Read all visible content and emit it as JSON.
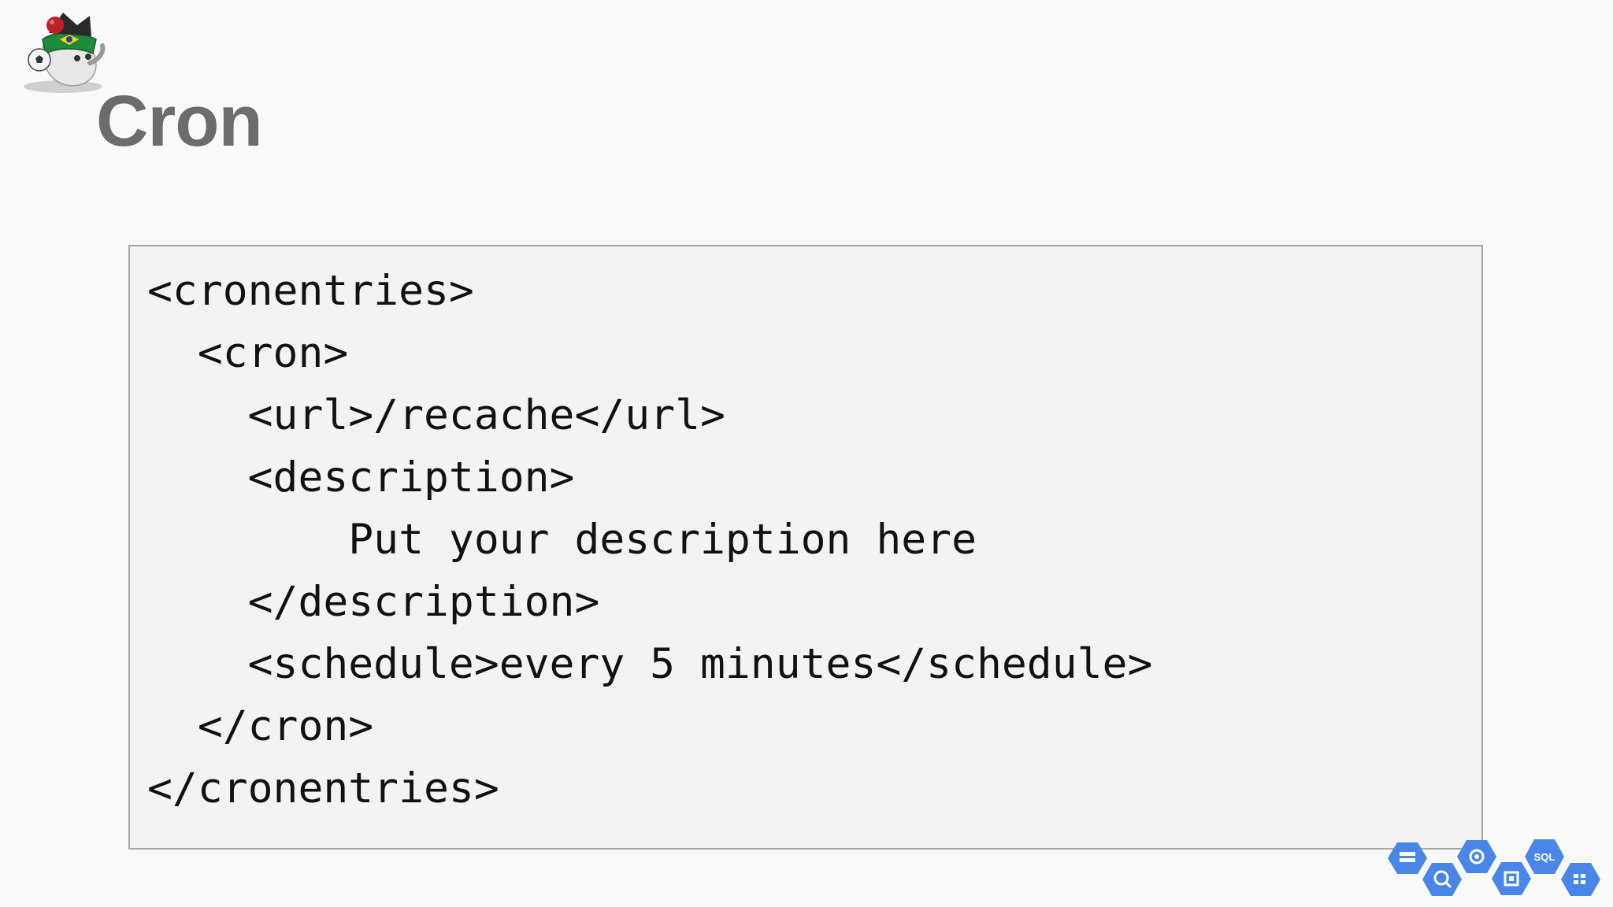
{
  "slide": {
    "title": "Cron",
    "code_lines": [
      "<cronentries>",
      "  <cron>",
      "    <url>/recache</url>",
      "    <description>",
      "        Put your description here",
      "    </description>",
      "    <schedule>every 5 minutes</schedule>",
      "  </cron>",
      "</cronentries>"
    ],
    "product_logos": {
      "sql_label": "SQL"
    }
  },
  "colors": {
    "title": "#6c6c6c",
    "code_background": "#f4f2f3",
    "code_border": "#a6a6a6",
    "logo_blue": "#4a86e8"
  },
  "icons": {
    "mascot": "cloud-mascot-icon",
    "storage": "storage-icon",
    "bigquery": "bigquery-icon",
    "endpoints": "endpoints-icon",
    "compute": "compute-engine-icon",
    "sql": "cloud-sql-icon",
    "app": "app-engine-icon"
  }
}
